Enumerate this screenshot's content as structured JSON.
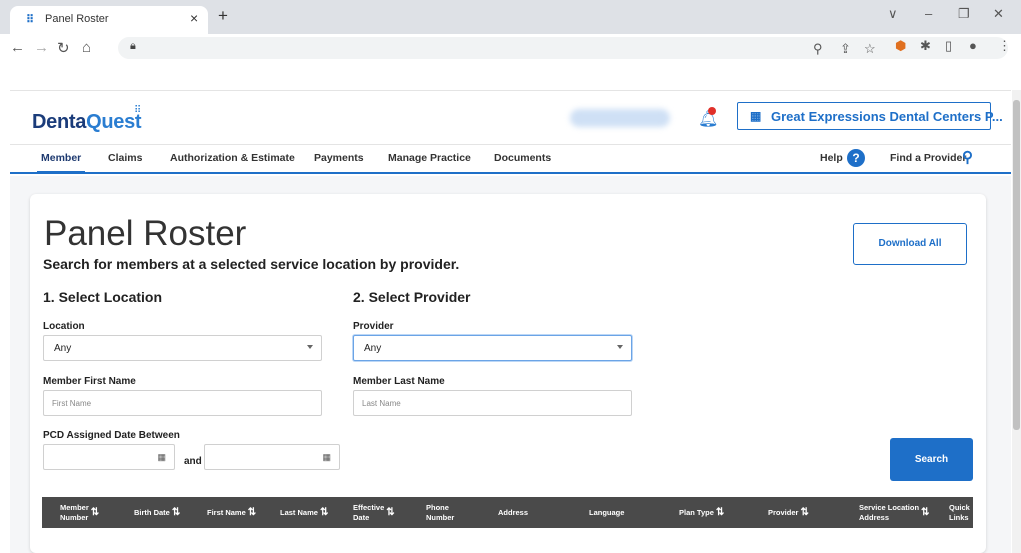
{
  "browser": {
    "tab_title": "Panel Roster",
    "tab_close": "×",
    "new_tab": "+",
    "window_controls": [
      "∨",
      "–",
      "❐",
      "✕"
    ]
  },
  "header": {
    "logo_dentaquest_a": "Denta",
    "logo_dentaquest_b": "Quest",
    "logo_mark": "⠿",
    "org_button_label": "Great Expressions Dental Centers P...",
    "org_icon": "building-icon"
  },
  "nav": {
    "items": [
      "Member",
      "Claims",
      "Authorization & Estimate",
      "Payments",
      "Manage Practice",
      "Documents"
    ],
    "help": "Help",
    "help_icon": "?",
    "find_provider": "Find a Provider"
  },
  "page": {
    "title": "Panel Roster",
    "subtitle": "Search for members at a selected service location by provider.",
    "download_all": "Download All",
    "step1": "1. Select Location",
    "step2": "2. Select Provider",
    "location_label": "Location",
    "location_value": "Any",
    "provider_label": "Provider",
    "provider_value": "Any",
    "first_name_label": "Member First Name",
    "first_name_placeholder": "First Name",
    "last_name_label": "Member Last Name",
    "last_name_placeholder": "Last Name",
    "pcd_label": "PCD Assigned Date Between",
    "and": "and",
    "search": "Search"
  },
  "table": {
    "columns": [
      {
        "label_a": "Member",
        "label_b": "Number",
        "sortable": true
      },
      {
        "label_a": "Birth Date",
        "label_b": "",
        "sortable": true
      },
      {
        "label_a": "First Name",
        "label_b": "",
        "sortable": true
      },
      {
        "label_a": "Last Name",
        "label_b": "",
        "sortable": true
      },
      {
        "label_a": "Effective",
        "label_b": "Date",
        "sortable": true
      },
      {
        "label_a": "Phone",
        "label_b": "Number",
        "sortable": false
      },
      {
        "label_a": "Address",
        "label_b": "",
        "sortable": false
      },
      {
        "label_a": "Language",
        "label_b": "",
        "sortable": false
      },
      {
        "label_a": "Plan Type",
        "label_b": "",
        "sortable": true
      },
      {
        "label_a": "Provider",
        "label_b": "",
        "sortable": true
      },
      {
        "label_a": "Service Location",
        "label_b": "Address",
        "sortable": true
      },
      {
        "label_a": "Quick",
        "label_b": "Links",
        "sortable": false
      }
    ]
  },
  "colors": {
    "brand_blue": "#1e6fc8",
    "table_header": "#4a4a4a"
  }
}
